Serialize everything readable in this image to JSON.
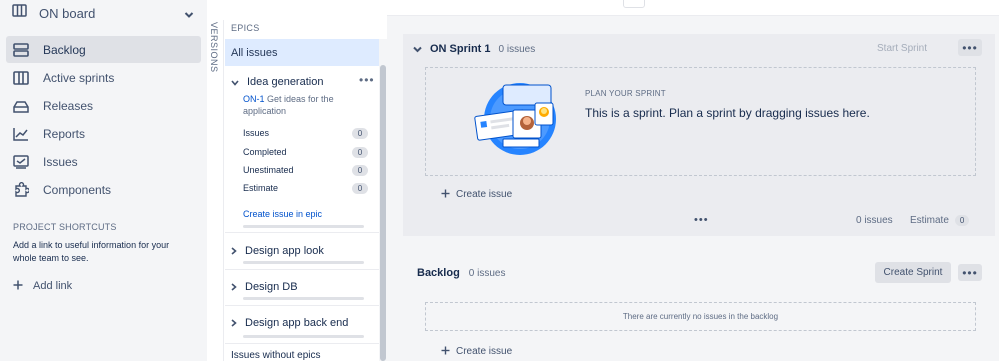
{
  "sidebar": {
    "board_label": "ON board",
    "nav": [
      {
        "label": "Backlog",
        "icon": "backlog-icon",
        "active": true
      },
      {
        "label": "Active sprints",
        "icon": "active-sprints-icon"
      },
      {
        "label": "Releases",
        "icon": "releases-icon"
      },
      {
        "label": "Reports",
        "icon": "reports-icon"
      },
      {
        "label": "Issues",
        "icon": "issues-icon"
      },
      {
        "label": "Components",
        "icon": "components-icon"
      }
    ],
    "shortcuts_title": "PROJECT SHORTCUTS",
    "shortcuts_desc": "Add a link to useful information for your whole team to see.",
    "add_link": "Add link"
  },
  "versions_label": "VERSIONS",
  "epics": {
    "title": "EPICS",
    "all_issues": "All issues",
    "items": [
      {
        "name": "Idea generation",
        "expanded": true,
        "color": "#8b572a",
        "key": "ON-1",
        "summary": "Get ideas for the application",
        "stats": [
          {
            "label": "Issues",
            "value": "0"
          },
          {
            "label": "Completed",
            "value": "0"
          },
          {
            "label": "Unestimated",
            "value": "0"
          },
          {
            "label": "Estimate",
            "value": "0"
          }
        ],
        "create_label": "Create issue in epic"
      },
      {
        "name": "Design app look",
        "color": "#f6c342"
      },
      {
        "name": "Design DB",
        "color": "#8993a4"
      },
      {
        "name": "Design app back end",
        "color": "#e95496"
      }
    ],
    "without_epics": "Issues without epics"
  },
  "sprint": {
    "name": "ON Sprint 1",
    "count": "0 issues",
    "start_label": "Start Sprint",
    "more": "•••",
    "plan_title": "PLAN YOUR SPRINT",
    "plan_text": "This is a sprint. Plan a sprint by dragging issues here.",
    "create_issue": "Create issue",
    "footer_dots": "•••",
    "footer_issues": "0 issues",
    "footer_estimate_label": "Estimate",
    "footer_estimate_value": "0"
  },
  "backlog": {
    "name": "Backlog",
    "count": "0 issues",
    "create_sprint": "Create Sprint",
    "more": "•••",
    "empty_text": "There are currently no issues in the backlog",
    "create_issue": "Create issue"
  },
  "colors": {
    "accent": "#0052cc",
    "sidebar_bg": "#f4f5f7",
    "selected_bg": "#deebff"
  }
}
